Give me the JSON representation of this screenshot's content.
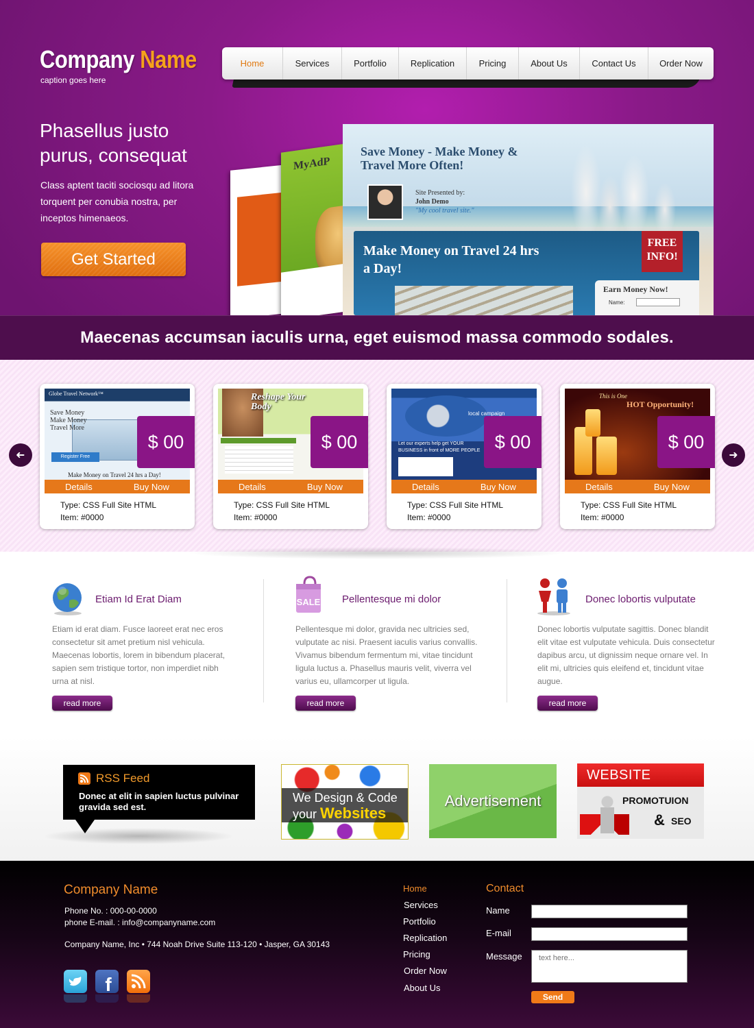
{
  "header": {
    "logo_part1": "Company",
    "logo_part2": "Name",
    "caption": "caption goes here",
    "nav": [
      "Home",
      "Services",
      "Portfolio",
      "Replication",
      "Pricing",
      "About Us",
      "Contact Us",
      "Order Now"
    ],
    "active_nav": "Home"
  },
  "hero": {
    "title": "Phasellus justo purus, consequat",
    "text": "Class aptent taciti sociosqu ad litora torquent per conubia nostra, per inceptos himenaeos.",
    "cta": "Get Started",
    "preview": {
      "back_label": "MyAdP",
      "headline": "Save Money - Make Money & Travel More Often!",
      "presented_by": "Site Presented by:",
      "presenter_name": "John Demo",
      "presenter_tagline": "\"My cool travel site.\"",
      "panel_title": "Make Money on Travel 24 hrs a Day!",
      "ribbon": "FREE INFO!",
      "form_title": "Earn Money Now!",
      "form_field": "Name:"
    }
  },
  "band": {
    "text": "Maecenas accumsan iaculis urna, eget euismod massa commodo sodales."
  },
  "carousel": {
    "prev_icon": "arrow-left-icon",
    "next_icon": "arrow-right-icon",
    "cards": [
      {
        "price": "$ 00",
        "details": "Details",
        "buy": "Buy Now",
        "type": "Type: CSS Full Site HTML",
        "item": "Item: #0000",
        "thumb": {
          "title": "Globe Travel Network™",
          "lines": "Save Money Make Money Travel More",
          "btn": "Register Free",
          "footer": "Make Money on Travel 24 hrs a Day!"
        }
      },
      {
        "price": "$ 00",
        "details": "Details",
        "buy": "Buy Now",
        "type": "Type: CSS Full Site HTML",
        "item": "Item: #0000",
        "thumb": {
          "title": "Reshape Your Body"
        }
      },
      {
        "price": "$ 00",
        "details": "Details",
        "buy": "Buy Now",
        "type": "Type: CSS Full Site HTML",
        "item": "Item: #0000",
        "thumb": {
          "title": "local campaign",
          "lines": "Let our experts help get YOUR BUSINESS in front of MORE PEOPLE"
        }
      },
      {
        "price": "$ 00",
        "details": "Details",
        "buy": "Buy Now",
        "type": "Type: CSS Full Site HTML",
        "item": "Item: #0000",
        "thumb": {
          "title": "This is One",
          "lines": "HOT Opportunity!"
        }
      }
    ]
  },
  "features": [
    {
      "icon": "globe-icon",
      "title": "Etiam Id Erat Diam",
      "body": "Etiam id erat diam. Fusce laoreet erat nec eros consectetur sit amet pretium nisl vehicula. Maecenas lobortis, lorem in bibendum placerat, sapien sem tristique tortor, non imperdiet nibh urna at nisl.",
      "more": "read more"
    },
    {
      "icon": "sale-bag-icon",
      "icon_text": "SALE",
      "title": "Pellentesque mi dolor",
      "body": "Pellentesque mi dolor, gravida nec ultricies sed, vulputate ac nisi. Praesent iaculis varius convallis. Vivamus bibendum fermentum mi, vitae tincidunt ligula luctus a. Phasellus mauris velit, viverra vel varius eu, ullamcorper ut ligula.",
      "more": "read more"
    },
    {
      "icon": "people-icon",
      "title": "Donec lobortis vulputate",
      "body": "Donec lobortis vulputate sagittis. Donec blandit elit vitae est vulputate vehicula. Duis consectetur dapibus arcu, ut dignissim neque ornare vel. In elit mi, ultricies quis eleifend et, tincidunt vitae augue.",
      "more": "read more"
    }
  ],
  "promos": {
    "rss_title": "RSS Feed",
    "rss_text": "Donec at elit in sapien luctus pulvinar gravida sed est.",
    "ad1_line1": "We Design & Code",
    "ad1_line2a": "your",
    "ad1_line2b": "Websites",
    "ad2": "Advertisement",
    "ad3_top": "WEBSITE",
    "ad3_mid": "PROMOTUION",
    "ad3_amp": "&",
    "ad3_seo": "SEO"
  },
  "footer": {
    "company": "Company Name",
    "phone": "Phone No. : 000-00-0000",
    "email": "phone E-mail. : info@companyname.com",
    "address": "Company Name, Inc • 744 Noah Drive Suite 113-120 • Jasper, GA 30143",
    "social": [
      "twitter-icon",
      "facebook-icon",
      "rss-icon"
    ],
    "nav": [
      "Home",
      "Services",
      "Portfolio",
      "Replication",
      "Pricing",
      "Order Now",
      "About Us"
    ],
    "contact_title": "Contact",
    "name_label": "Name",
    "email_label": "E-mail",
    "message_label": "Message",
    "message_placeholder": "text here...",
    "send": "Send"
  },
  "colors": {
    "brand_purple": "#8a1a88",
    "accent_orange": "#f08c2c",
    "dark_band": "#4e0e4d"
  }
}
